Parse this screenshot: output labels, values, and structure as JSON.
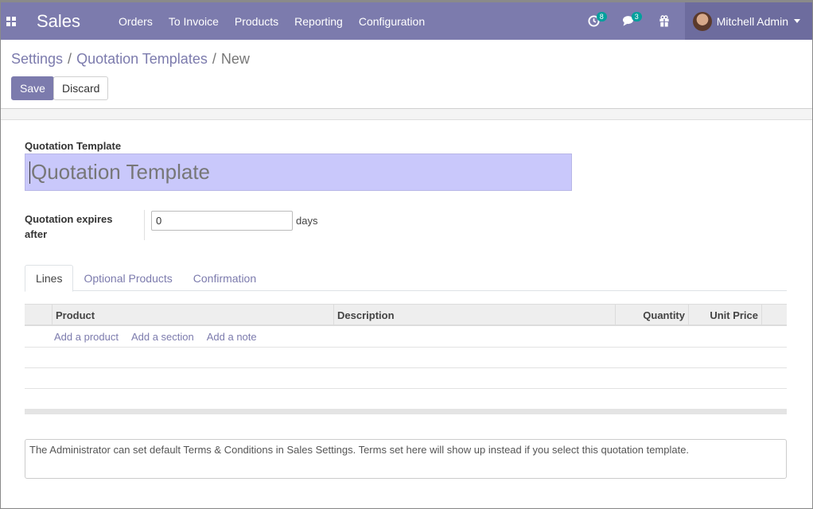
{
  "navbar": {
    "app_name": "Sales",
    "menu": [
      "Orders",
      "To Invoice",
      "Products",
      "Reporting",
      "Configuration"
    ],
    "activity_badge": "8",
    "messages_badge": "3",
    "user_name": "Mitchell Admin",
    "color": "#7c7bad"
  },
  "breadcrumb": {
    "items": [
      "Settings",
      "Quotation Templates"
    ],
    "current": "New",
    "separator": "/"
  },
  "buttons": {
    "save": "Save",
    "discard": "Discard"
  },
  "form": {
    "title_label": "Quotation Template",
    "title_placeholder": "Quotation Template",
    "expires_label": "Quotation expires after",
    "expires_value": "0",
    "expires_unit": "days"
  },
  "tabs": [
    "Lines",
    "Optional Products",
    "Confirmation"
  ],
  "table": {
    "columns": [
      "Product",
      "Description",
      "Quantity",
      "Unit Price"
    ],
    "add_links": [
      "Add a product",
      "Add a section",
      "Add a note"
    ]
  },
  "notes": {
    "text": "The Administrator can set default Terms & Conditions in Sales Settings. Terms set here will show up instead if you select this quotation template."
  }
}
